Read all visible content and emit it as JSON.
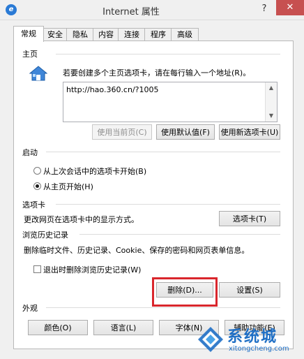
{
  "window": {
    "title": "Internet 属性",
    "help": "?",
    "close": "✕"
  },
  "tabs": [
    "常规",
    "安全",
    "隐私",
    "内容",
    "连接",
    "程序",
    "高级"
  ],
  "home": {
    "label": "主页",
    "description": "若要创建多个主页选项卡，请在每行输入一个地址(R)。",
    "url": "http://hao.360.cn/?1005",
    "btn_current": "使用当前页(C)",
    "btn_default": "使用默认值(F)",
    "btn_new_tab": "使用新选项卡(U)"
  },
  "startup": {
    "label": "启动",
    "option_last": "从上次会话中的选项卡开始(B)",
    "option_home": "从主页开始(H)"
  },
  "tabs_section": {
    "label": "选项卡",
    "description": "更改网页在选项卡中的显示方式。",
    "button": "选项卡(T)"
  },
  "history": {
    "label": "浏览历史记录",
    "description": "删除临时文件、历史记录、Cookie、保存的密码和网页表单信息。",
    "checkbox_label": "退出时删除浏览历史记录(W)",
    "delete_button": "删除(D)...",
    "settings_button": "设置(S)"
  },
  "appearance": {
    "label": "外观",
    "colors": "颜色(O)",
    "languages": "语言(L)",
    "fonts": "字体(N)",
    "accessibility": "辅助功能(E)"
  },
  "watermark": {
    "title": "系统城",
    "url": "xitongcheng.com"
  },
  "colors": {
    "close_bg": "#c75050",
    "highlight": "#d9262c",
    "watermark": "#1f6fc5"
  }
}
